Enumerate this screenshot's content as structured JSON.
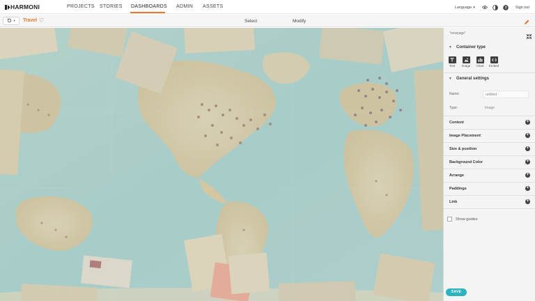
{
  "app": {
    "logo_text": "HARMONI"
  },
  "nav": {
    "items": [
      {
        "label": "PROJECTS"
      },
      {
        "label": "STORIES"
      },
      {
        "label": "DASHBOARDS",
        "active": true
      },
      {
        "label": "ADMIN"
      },
      {
        "label": "ASSETS"
      }
    ],
    "language_label": "Language",
    "sign_out_label": "Sign out",
    "accent_color": "#e8772e"
  },
  "toolbar": {
    "story_name": "Travel",
    "tabs": [
      "Select",
      "Modify"
    ],
    "icons": [
      "history-icon",
      "heart-icon",
      "pencil-icon"
    ]
  },
  "canvas": {
    "content": "world-map-image"
  },
  "panel": {
    "title": "\"newpage\"",
    "container_type": {
      "heading": "Container type",
      "options": [
        {
          "label": "Text",
          "icon": "text-icon"
        },
        {
          "label": "Image",
          "icon": "image-icon"
        },
        {
          "label": "Chart",
          "icon": "chart-icon"
        },
        {
          "label": "Embed",
          "icon": "embed-icon"
        }
      ]
    },
    "general_settings": {
      "heading": "General settings",
      "name_label": "Name:",
      "name_value": "untitled",
      "type_label": "Type:",
      "type_value": "Image"
    },
    "sections": [
      "Content",
      "Image Placement",
      "Size & position",
      "Background Color",
      "Arrange",
      "Paddings",
      "Link"
    ],
    "show_guides_label": "Show guides",
    "save_label": "SAVE",
    "save_color": "#2fb3c0"
  }
}
